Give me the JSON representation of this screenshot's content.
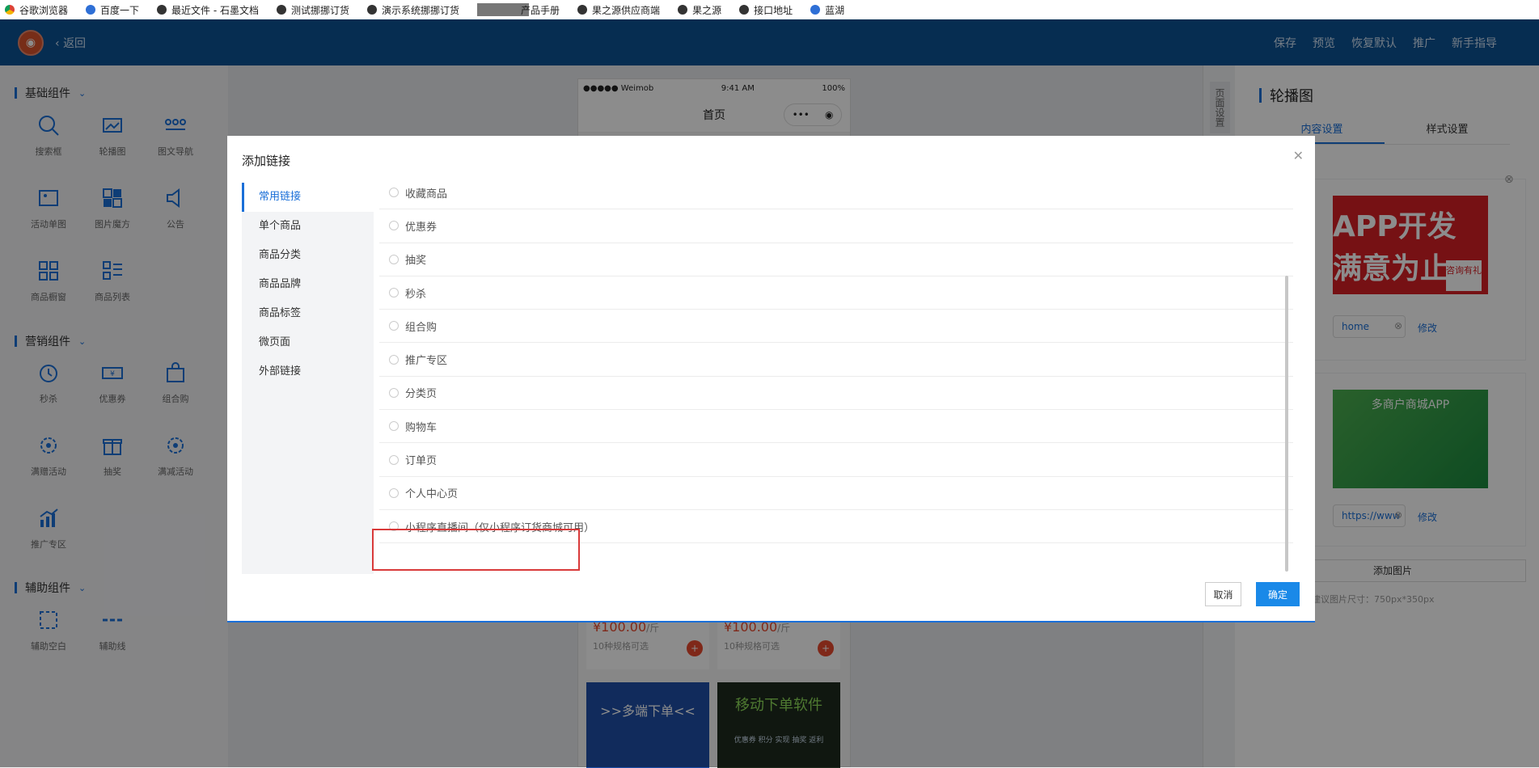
{
  "bookmarks": [
    {
      "label": "谷歌浏览器",
      "icon": "chrome-icon"
    },
    {
      "label": "百度一下",
      "icon": "baidu-paw-icon"
    },
    {
      "label": "最近文件 - 石墨文档",
      "icon": "shimo-icon"
    },
    {
      "label": "测试挪挪订货",
      "icon": "globe-icon"
    },
    {
      "label": "演示系统挪挪订货",
      "icon": "globe-icon"
    },
    {
      "label": "产品手册",
      "icon": "masked-icon"
    },
    {
      "label": "果之源供应商端",
      "icon": "globe-icon"
    },
    {
      "label": "果之源",
      "icon": "globe-icon"
    },
    {
      "label": "接口地址",
      "icon": "github-icon"
    },
    {
      "label": "蓝湖",
      "icon": "lanhu-icon"
    }
  ],
  "topbar": {
    "back_label": "返回",
    "actions": [
      "保存",
      "预览",
      "恢复默认",
      "推广",
      "新手指导"
    ]
  },
  "left_panel": {
    "groups": [
      {
        "title": "基础组件",
        "items": [
          {
            "label": "搜索框",
            "icon": "search-icon"
          },
          {
            "label": "轮播图",
            "icon": "carousel-icon"
          },
          {
            "label": "图文导航",
            "icon": "nav-dots-icon"
          },
          {
            "label": "活动单图",
            "icon": "image-icon"
          },
          {
            "label": "图片魔方",
            "icon": "cube-grid-icon"
          },
          {
            "label": "公告",
            "icon": "speaker-icon"
          },
          {
            "label": "商品橱窗",
            "icon": "grid-icon"
          },
          {
            "label": "商品列表",
            "icon": "list-icon"
          }
        ]
      },
      {
        "title": "营销组件",
        "items": [
          {
            "label": "秒杀",
            "icon": "clock-icon"
          },
          {
            "label": "优惠券",
            "icon": "ticket-icon"
          },
          {
            "label": "组合购",
            "icon": "bag-icon"
          },
          {
            "label": "满赠活动",
            "icon": "gear-badge-icon"
          },
          {
            "label": "抽奖",
            "icon": "gift-icon"
          },
          {
            "label": "满减活动",
            "icon": "gear-badge-icon"
          },
          {
            "label": "推广专区",
            "icon": "bar-chart-icon"
          }
        ]
      },
      {
        "title": "辅助组件",
        "items": [
          {
            "label": "辅助空白",
            "icon": "dashed-square-icon"
          },
          {
            "label": "辅助线",
            "icon": "dashed-line-icon"
          }
        ]
      }
    ]
  },
  "phone": {
    "carrier": "●●●●● Weimob",
    "time": "9:41 AM",
    "battery": "100%",
    "title": "首页",
    "products": [
      {
        "price": "¥100.00",
        "unit": "/斤",
        "spec": "10种规格可选"
      },
      {
        "price": "¥100.00",
        "unit": "/斤",
        "spec": "10种规格可选"
      }
    ],
    "promo1": ">>多端下单<<",
    "promo2": "移动下单软件",
    "promo2_tags": "优惠券 积分 实现 抽奖 返利"
  },
  "right_strip": {
    "tab": "页面设置"
  },
  "right_panel": {
    "title": "轮播图",
    "tabs": [
      "内容设置",
      "样式设置"
    ],
    "banner1_text": "APP开发 满意为止",
    "banner1_badge": "咨询有礼",
    "banner1_link": "home",
    "banner2_text": "多商户商城APP",
    "banner2_link": "https://www",
    "edit_label": "修改",
    "add_image": "添加图片",
    "hint": "轮播图片，建议图片尺寸：750px*350px"
  },
  "modal": {
    "title": "添加链接",
    "nav": [
      "常用链接",
      "单个商品",
      "商品分类",
      "商品品牌",
      "商品标签",
      "微页面",
      "外部链接"
    ],
    "options": [
      "收藏商品",
      "优惠券",
      "抽奖",
      "秒杀",
      "组合购",
      "推广专区",
      "分类页",
      "购物车",
      "订单页",
      "个人中心页",
      "小程序直播间（仅小程序订货商城可用）"
    ],
    "cancel": "取消",
    "confirm": "确定"
  },
  "colors": {
    "header": "#0b5394",
    "accent": "#1a6fd8",
    "highlight": "#d93a3a"
  }
}
